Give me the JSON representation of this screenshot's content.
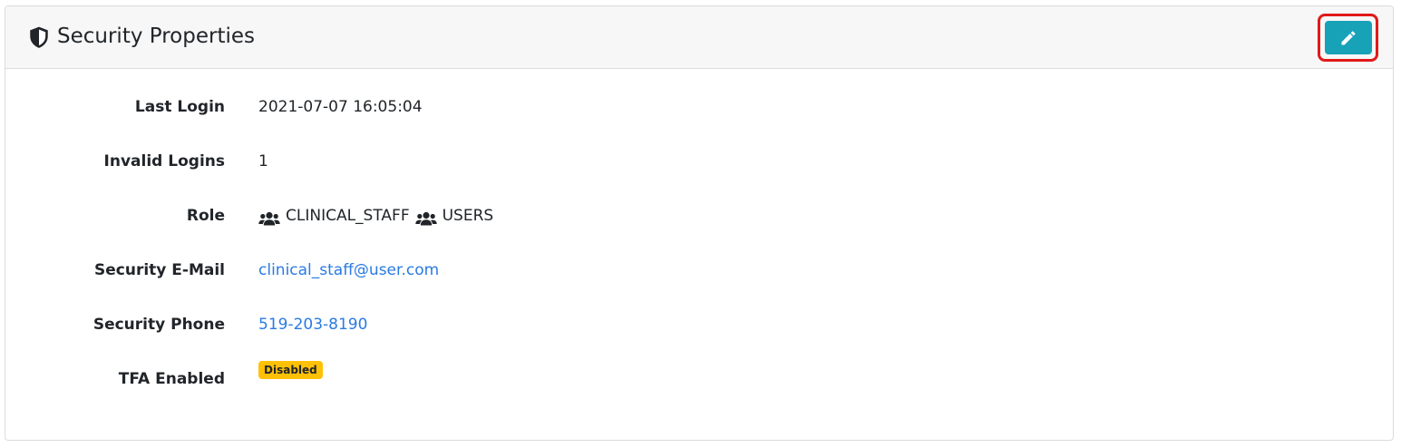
{
  "header": {
    "title": "Security Properties",
    "icon": "shield-icon",
    "edit_icon": "pencil-icon"
  },
  "fields": {
    "last_login": {
      "label": "Last Login",
      "value": "2021-07-07 16:05:04"
    },
    "invalid_logins": {
      "label": "Invalid Logins",
      "value": "1"
    },
    "role": {
      "label": "Role",
      "values": [
        "CLINICAL_STAFF",
        "USERS"
      ],
      "icon": "users-icon"
    },
    "security_email": {
      "label": "Security E-Mail",
      "value": "clinical_staff@user.com"
    },
    "security_phone": {
      "label": "Security Phone",
      "value": "519-203-8190"
    },
    "tfa_enabled": {
      "label": "TFA Enabled",
      "value": "Disabled"
    }
  },
  "colors": {
    "edit_button": "#17a2b8",
    "highlight": "#e11919",
    "link": "#2a7ae2",
    "badge_warning": "#ffc107"
  }
}
